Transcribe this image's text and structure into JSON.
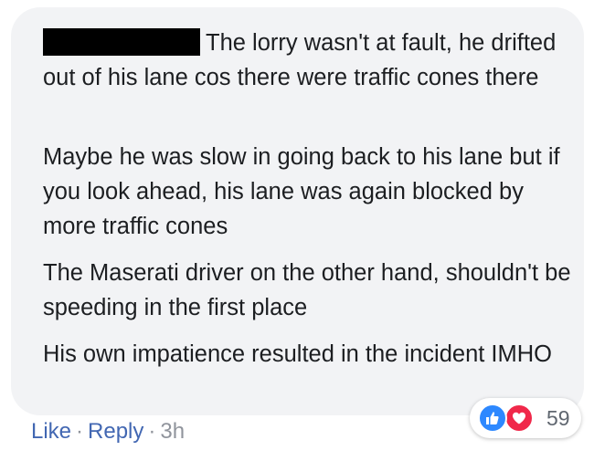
{
  "comment": {
    "paragraphs": [
      "The lorry wasn't at fault, he drifted out of his lane cos there were traffic cones there",
      "Maybe he was slow in going back to his lane but if you look ahead, his lane was again blocked by more traffic cones",
      "The Maserati driver on the other hand, shouldn't be speeding in the first place",
      "His own impatience resulted in the incident IMHO"
    ]
  },
  "actions": {
    "like": "Like",
    "separator": "·",
    "reply": "Reply",
    "time": "3h"
  },
  "reactions": {
    "icons": [
      "like-icon",
      "love-icon"
    ],
    "count": "59"
  },
  "colors": {
    "bubble": "#f2f3f5",
    "link": "#4267b2",
    "like": "#2d88ff",
    "love": "#f0284a"
  }
}
